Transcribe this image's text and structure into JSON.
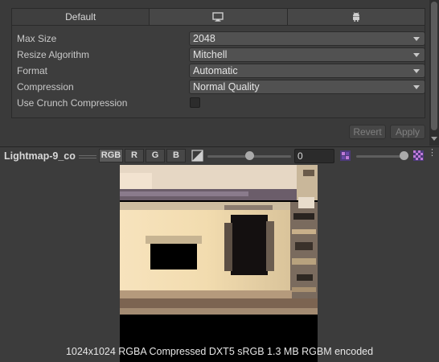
{
  "platform_tabs": {
    "default_label": "Default",
    "tabs": [
      {
        "label": "Default",
        "icon": null,
        "active": true
      },
      {
        "label": "",
        "icon": "monitor-icon",
        "active": false
      },
      {
        "label": "",
        "icon": "android-icon",
        "active": false
      }
    ]
  },
  "settings": {
    "max_size": {
      "label": "Max Size",
      "value": "2048"
    },
    "resize_algorithm": {
      "label": "Resize Algorithm",
      "value": "Mitchell"
    },
    "format": {
      "label": "Format",
      "value": "Automatic"
    },
    "compression": {
      "label": "Compression",
      "value": "Normal Quality"
    },
    "use_crunch": {
      "label": "Use Crunch Compression",
      "checked": false
    }
  },
  "buttons": {
    "revert": "Revert",
    "apply": "Apply"
  },
  "preview_toolbar": {
    "title": "Lightmap-9_co",
    "channels": [
      "RGB",
      "R",
      "G",
      "B"
    ],
    "active_channel": "RGB",
    "exposure_value": "0",
    "exposure_slider_fraction": 0.5,
    "mip_slider_fraction": 1.0
  },
  "preview_info": {
    "text": "1024x1024  RGBA Compressed DXT5 sRGB   1.3 MB   RGBM encoded"
  },
  "colors": {
    "panel_bg": "#3a3a3a",
    "dropdown_bg": "#515151",
    "text": "#c4c4c4"
  }
}
